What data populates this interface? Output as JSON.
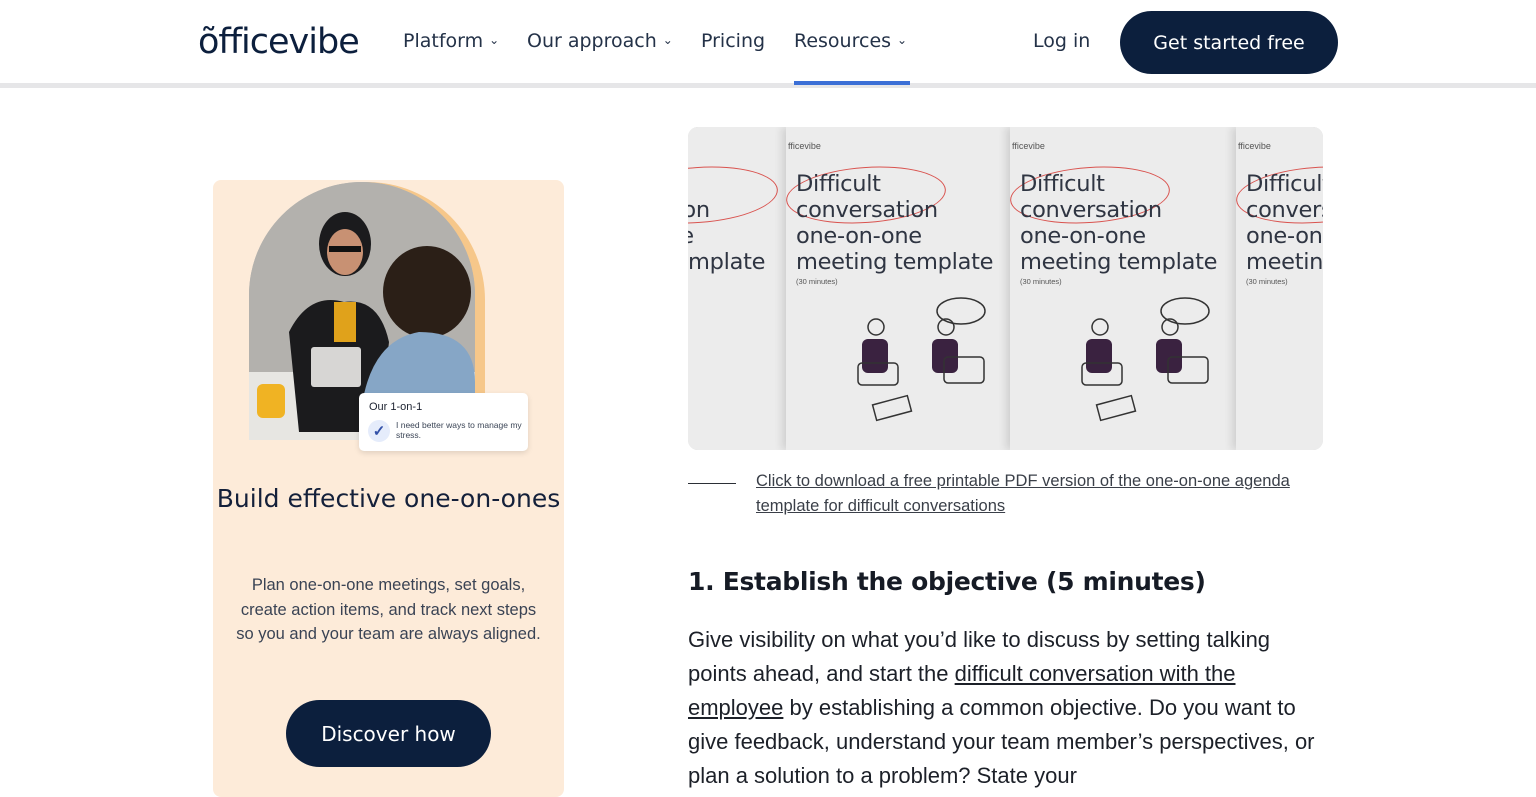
{
  "header": {
    "logo": "õfficevibe",
    "nav": [
      {
        "label": "Platform",
        "dropdown": true
      },
      {
        "label": "Our approach",
        "dropdown": true
      },
      {
        "label": "Pricing",
        "dropdown": false
      },
      {
        "label": "Resources",
        "dropdown": true,
        "active": true
      }
    ],
    "login": "Log in",
    "cta": "Get started free"
  },
  "promo": {
    "chip_title": "Our 1-on-1",
    "chip_text": "I need better ways to manage my stress.",
    "title": "Build effective one-on-ones",
    "description": "Plan one-on-one meetings, set goals, create action items, and track next steps so you and your team are always aligned.",
    "button": "Discover how"
  },
  "hero": {
    "brand": "fficevibe",
    "title_l1": "Difficult",
    "title_l2": "conversation",
    "title_l3": "one-on-one",
    "title_l4": "meeting template",
    "subtitle": "(30 minutes)"
  },
  "article": {
    "caption": "Click to download a free printable PDF version of the one-on-one agenda template for difficult conversations",
    "heading": "1. Establish the objective (5 minutes)",
    "body_before": "Give visibility on what you’d like to discuss by setting talking points ahead, and start the ",
    "body_link": "difficult conversation with the employee",
    "body_after": " by establishing a common objective. Do you want to give feedback, understand your team member’s perspectives, or plan a solution to a problem? State your"
  },
  "colors": {
    "navy": "#0c1f3d",
    "promo_bg": "#fdebd9",
    "arch_accent": "#f6c78a",
    "nav_active": "#3b6fd6"
  }
}
